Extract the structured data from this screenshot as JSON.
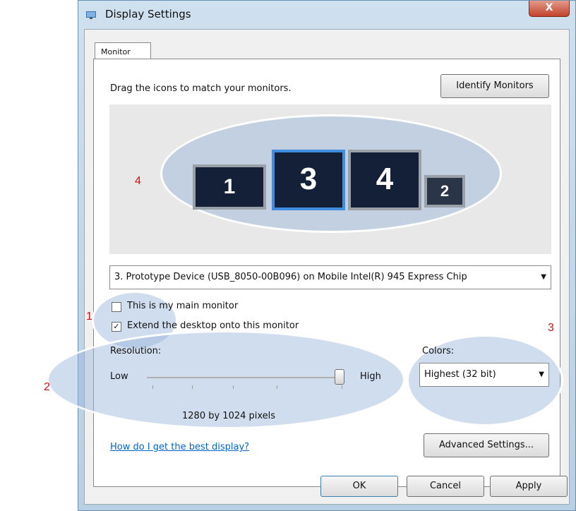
{
  "window": {
    "title": "Display Settings",
    "close_label": "X"
  },
  "tabs": [
    {
      "label": "Monitor"
    }
  ],
  "instruction": "Drag the icons to match your monitors.",
  "identify_button": "Identify Monitors",
  "monitors": [
    {
      "number": "1",
      "selected": false
    },
    {
      "number": "3",
      "selected": true
    },
    {
      "number": "4",
      "selected": false
    },
    {
      "number": "2",
      "selected": false
    }
  ],
  "callouts": {
    "c1": "1",
    "c2": "2",
    "c3": "3",
    "c4": "4"
  },
  "device_select": {
    "value": "3. Prototype Device (USB_8050-00B096) on Mobile Intel(R) 945 Express Chip"
  },
  "checkboxes": [
    {
      "label": "This is my main monitor",
      "checked": false
    },
    {
      "label": "Extend the desktop onto this monitor",
      "checked": true
    }
  ],
  "resolution": {
    "label": "Resolution:",
    "low": "Low",
    "high": "High",
    "value_text": "1280 by 1024 pixels",
    "slider_level": 1.0
  },
  "colors": {
    "label": "Colors:",
    "value": "Highest (32 bit)"
  },
  "help_link": "How do I get the best display?",
  "advanced_button": "Advanced Settings...",
  "footer": {
    "ok": "OK",
    "cancel": "Cancel",
    "apply": "Apply"
  }
}
